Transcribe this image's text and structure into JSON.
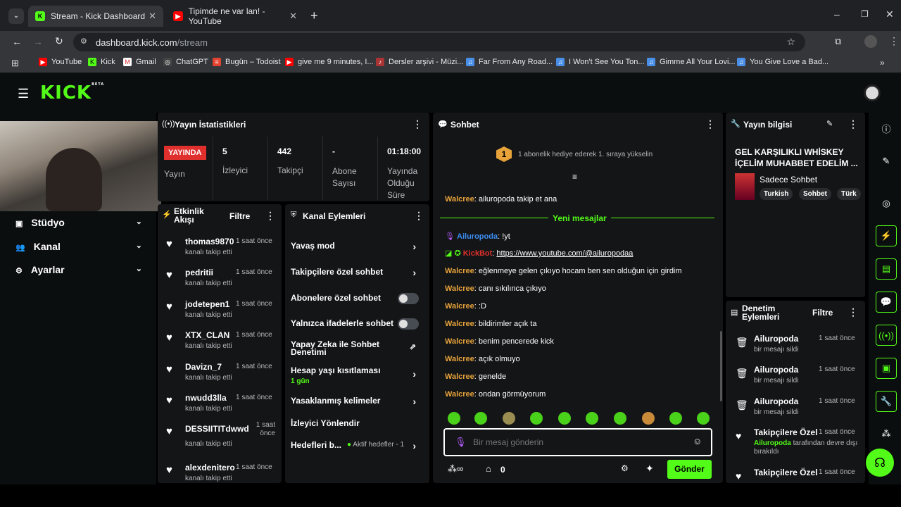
{
  "browser": {
    "tabs": [
      {
        "title": "Stream - Kick Dashboard",
        "active": true
      },
      {
        "title": "Tipimde ne var lan! - YouTube",
        "active": false
      }
    ],
    "url_host": "dashboard.kick.com",
    "url_path": "/stream",
    "bookmarks": [
      "YouTube",
      "Kick",
      "Gmail",
      "ChatGPT",
      "Bugün – Todoist",
      "give me 9 minutes, I...",
      "Dersler arşivi - Müzi...",
      "Far From Any Road...",
      "I Won't See You Ton...",
      "Gimme All Your Lovi...",
      "You Give Love a Bad..."
    ]
  },
  "kick": {
    "logo": "KICK",
    "beta": "BETA"
  },
  "leftnav": {
    "items": [
      "Stüdyo",
      "Kanal",
      "Ayarlar"
    ]
  },
  "stats": {
    "title": "Yayın İstatistikleri",
    "live_badge": "YAYINDA",
    "live_label": "Yayın",
    "viewers_value": "5",
    "viewers_label": "İzleyici",
    "followers_value": "442",
    "followers_label": "Takipçi",
    "subs_value": "-",
    "subs_label": "Abone Sayısı",
    "uptime_value": "01:18:00",
    "uptime_label": "Yayında Olduğu Süre"
  },
  "activity": {
    "title": "Etkinlik Akışı",
    "filter": "Filtre",
    "items": [
      {
        "user": "thomas9870",
        "time": "1 saat önce",
        "action": "kanalı takip etti"
      },
      {
        "user": "pedritii",
        "time": "1 saat önce",
        "action": "kanalı takip etti"
      },
      {
        "user": "jodetepen1",
        "time": "1 saat önce",
        "action": "kanalı takip etti"
      },
      {
        "user": "XTX_CLAN",
        "time": "1 saat önce",
        "action": "kanalı takip etti"
      },
      {
        "user": "Davizn_7",
        "time": "1 saat önce",
        "action": "kanalı takip etti"
      },
      {
        "user": "nwudd3lla",
        "time": "1 saat önce",
        "action": "kanalı takip etti"
      },
      {
        "user": "DESSIITITdwwd",
        "time": "1 saat önce",
        "action": "kanalı takip etti"
      },
      {
        "user": "alexdenitero",
        "time": "1 saat önce",
        "action": "kanalı takip etti"
      }
    ]
  },
  "channel_actions": {
    "title": "Kanal Eylemleri",
    "items": [
      {
        "label": "Yavaş mod",
        "control": "chevron"
      },
      {
        "label": "Takipçilere özel sohbet",
        "control": "chevron"
      },
      {
        "label": "Abonelere özel sohbet",
        "control": "toggle"
      },
      {
        "label": "Yalnızca ifadelerle sohbet",
        "control": "toggle"
      },
      {
        "label": "Yapay Zeka ile Sohbet Denetimi",
        "control": "external"
      },
      {
        "label": "Hesap yaşı kısıtlaması",
        "sub": "1 gün",
        "control": "chevron"
      },
      {
        "label": "Yasaklanmış kelimeler",
        "control": "chevron"
      },
      {
        "label": "İzleyici Yönlendir",
        "control": "none"
      },
      {
        "label": "Hedefleri b...",
        "sub": "Aktif hedefler - 1",
        "control": "chevron"
      }
    ]
  },
  "chat": {
    "title": "Sohbet",
    "gift_text": "1 abonelik hediye ederek 1. sıraya yükselin",
    "gift_rank": "1",
    "new_messages": "Yeni mesajlar",
    "messages": [
      {
        "user": "Walcree",
        "text": "ailuropoda takip et ana",
        "color": "#e7a33a"
      },
      {
        "user": "Ailuropoda",
        "text": "!yt",
        "color": "#3d8df0"
      },
      {
        "user": "KickBot",
        "text": "https://www.youtube.com/@ailuropodaa",
        "color": "#e0302d"
      },
      {
        "user": "Walcree",
        "text": "eğlenmeye gelen çıkıyo hocam ben sen olduğun için girdim",
        "color": "#e7a33a"
      },
      {
        "user": "Walcree",
        "text": "canı sıkılınca çıkıyo",
        "color": "#e7a33a"
      },
      {
        "user": "Walcree",
        "text": ":D",
        "color": "#e7a33a"
      },
      {
        "user": "Walcree",
        "text": "bildirimler açık ta",
        "color": "#e7a33a"
      },
      {
        "user": "Walcree",
        "text": "benim pencerede kick",
        "color": "#e7a33a"
      },
      {
        "user": "Walcree",
        "text": "açık olmuyo",
        "color": "#e7a33a"
      },
      {
        "user": "Walcree",
        "text": "genelde",
        "color": "#e7a33a"
      },
      {
        "user": "Walcree",
        "text": "ondan görmüyorum",
        "color": "#e7a33a"
      }
    ],
    "input_placeholder": "Bir mesaj gönderin",
    "points": "0",
    "send": "Gönder"
  },
  "stream_info": {
    "title": "Yayın bilgisi",
    "stream_title": "GEL KARŞILIKLI WHİSKEY İÇELİM MUHABBET EDELİM ...",
    "category": "Sadece Sohbet",
    "tags": [
      "Turkish",
      "Sohbet",
      "Türk"
    ]
  },
  "moderation": {
    "title": "Denetim Eylemleri",
    "filter": "Filtre",
    "items": [
      {
        "user": "Ailuropoda",
        "time": "1 saat önce",
        "action": "bir mesajı sildi"
      },
      {
        "user": "Ailuropoda",
        "time": "1 saat önce",
        "action": "bir mesajı sildi"
      },
      {
        "user": "Ailuropoda",
        "time": "1 saat önce",
        "action": "bir mesajı sildi"
      },
      {
        "user": "Takipçilere Özel",
        "time": "1 saat önce",
        "action_user": "Ailuropoda",
        "action": "tarafından devre dışı bırakıldı"
      },
      {
        "user": "Takipçilere Özel",
        "time": "1 saat önce",
        "action": ""
      }
    ]
  },
  "colors": {
    "brand": "#53fc18",
    "live": "#e0302d",
    "username": "#e7a33a"
  }
}
